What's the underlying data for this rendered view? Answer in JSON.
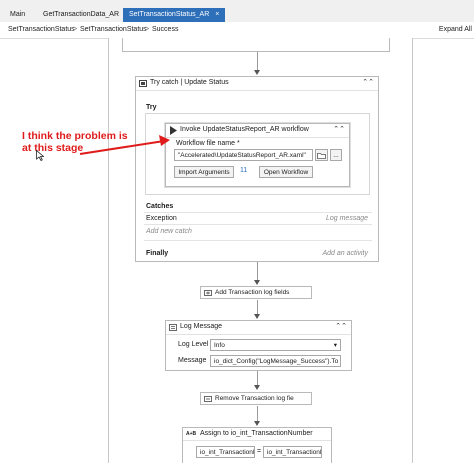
{
  "tabs": [
    {
      "label": "Main"
    },
    {
      "label": "GetTransactionData_AR"
    },
    {
      "label": "SetTransactionStatus_AR",
      "active": true
    }
  ],
  "tab_close_glyph": "×",
  "breadcrumb": {
    "items": [
      "SetTransactionStatus",
      "SetTransactionStatus",
      "Success"
    ],
    "separator": ">",
    "expand_all": "Expand All"
  },
  "try_catch": {
    "title": "Try catch | Update Status",
    "try_label": "Try",
    "invoke": {
      "title": "Invoke UpdateStatusReport_AR workflow",
      "field_label": "Workflow file name *",
      "file_value": "\"Accelerated\\UpdateStatusReport_AR.xaml\"",
      "browse_icon": "folder-icon",
      "more_label": "...",
      "import_button": "Import Arguments",
      "arg_count": "11",
      "open_button": "Open Workflow"
    },
    "catches_label": "Catches",
    "exception_label": "Exception",
    "log_message_hint": "Log message",
    "add_catch": "Add new catch",
    "finally_label": "Finally",
    "add_activity": "Add an activity"
  },
  "add_log_fields": "Add Transaction log fields",
  "log_message": {
    "title": "Log Message",
    "level_label": "Log Level",
    "level_value": "Info",
    "message_label": "Message",
    "message_value": "io_dict_Config(\"LogMessage_Success\").To"
  },
  "remove_log_field": "Remove Transaction log fie",
  "assign": {
    "badge": "A+B",
    "title": "Assign to io_int_TransactionNumber",
    "left_value": "io_int_Transactionl",
    "equals": "=",
    "right_value": "io_int_Transactionl"
  },
  "annotation": "I think the problem is at this stage",
  "colors": {
    "active_tab": "#2d6fb8",
    "annotation": "#e01b1b",
    "count_badge": "#2d6fb8"
  }
}
